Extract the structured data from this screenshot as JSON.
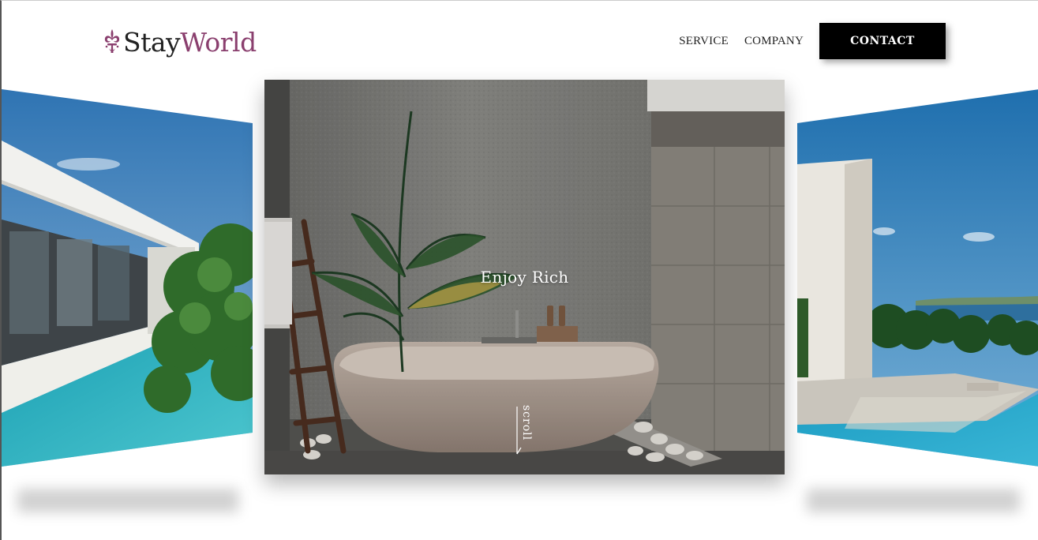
{
  "brand": {
    "name_part1": "Stay",
    "name_part2": "World"
  },
  "nav": {
    "links": [
      "SERVICE",
      "COMPANY"
    ],
    "cta": "CONTACT"
  },
  "hero": {
    "title": "Enjoy Rich",
    "scroll_label": "scroll"
  },
  "colors": {
    "brand_accent": "#8a3f6e",
    "cta_bg": "#000000",
    "cta_text": "#ffffff"
  },
  "icons": {
    "logo": "fleur-de-lis-icon",
    "scroll": "arrow-down-icon"
  }
}
